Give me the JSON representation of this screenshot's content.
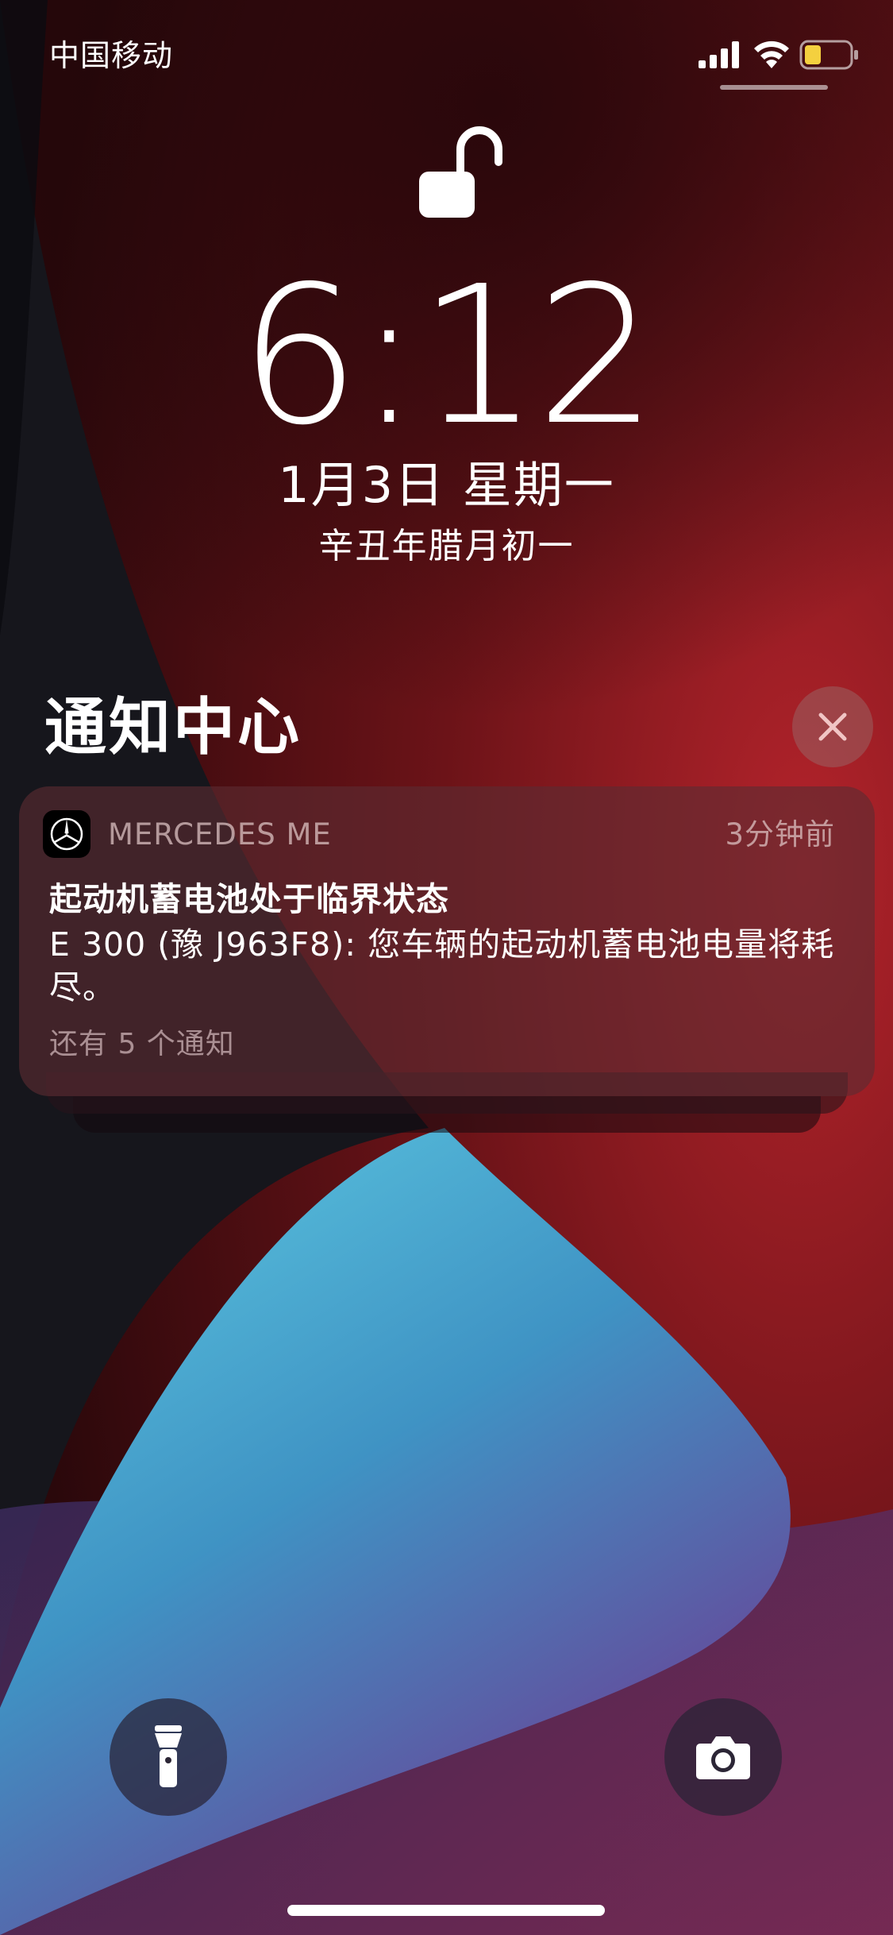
{
  "status_bar": {
    "carrier": "中国移动",
    "icons": [
      "cellular-signal-icon",
      "wifi-icon",
      "battery-icon"
    ],
    "battery_color": "#f4d03f"
  },
  "lock_screen": {
    "lock_icon": "unlock-icon",
    "time": "6:12",
    "date": "1月3日 星期一",
    "lunar_date": "辛丑年腊月初一"
  },
  "notification_center": {
    "title": "通知中心",
    "clear_icon": "close-icon",
    "notification": {
      "app_name": "MERCEDES ME",
      "time_ago": "3分钟前",
      "title": "起动机蓄电池处于临界状态",
      "body": "E 300 (豫 J963F8): 您车辆的起动机蓄电池电量将耗尽。",
      "more": "还有 5 个通知"
    }
  },
  "quick_actions": {
    "left_icon": "flashlight-icon",
    "right_icon": "camera-icon"
  },
  "colors": {
    "wallpaper_red": "#b8252d",
    "wallpaper_cyan": "#55c3dd",
    "wallpaper_purple": "#6a3f95"
  }
}
